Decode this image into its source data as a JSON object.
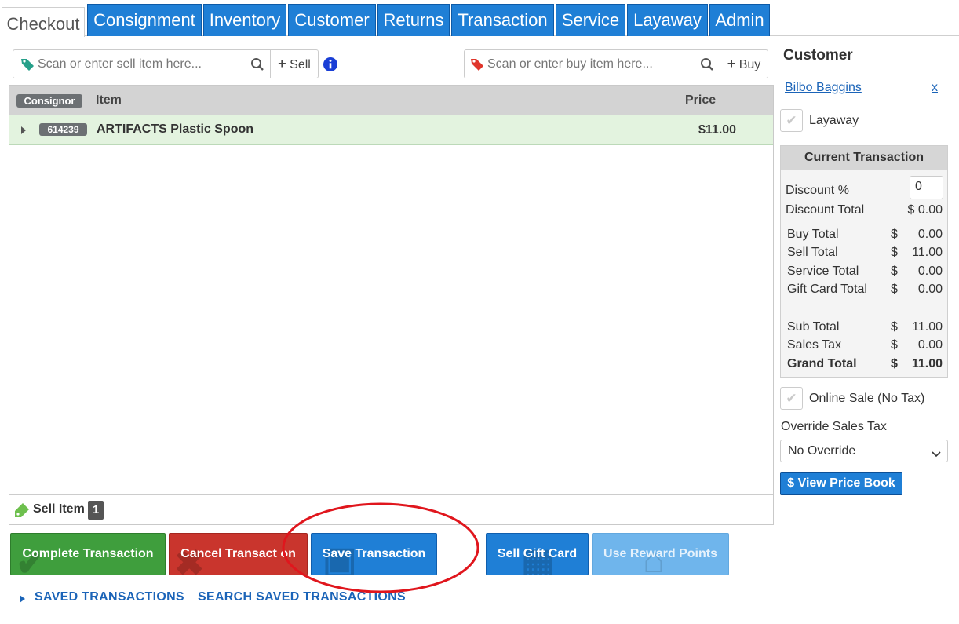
{
  "tabs": [
    {
      "label": "Checkout"
    },
    {
      "label": "Consignment"
    },
    {
      "label": "Inventory"
    },
    {
      "label": "Customer"
    },
    {
      "label": "Returns"
    },
    {
      "label": "Transaction"
    },
    {
      "label": "Service"
    },
    {
      "label": "Layaway"
    },
    {
      "label": "Admin"
    }
  ],
  "sell_search": {
    "placeholder": "Scan or enter sell item here...",
    "add_label": "Sell"
  },
  "buy_search": {
    "placeholder": "Scan or enter buy item here...",
    "add_label": "Buy"
  },
  "items_table": {
    "headers": {
      "consignor": "Consignor",
      "item": "Item",
      "price": "Price"
    },
    "rows": [
      {
        "consignor": "614239",
        "item": "ARTIFACTS Plastic Spoon",
        "price": "$11.00"
      }
    ],
    "footer": {
      "label": "Sell Item",
      "count": "1"
    }
  },
  "actions": {
    "complete": "Complete Transaction",
    "cancel": "Cancel Transact on",
    "save": "Save Transaction",
    "gift_card": "Sell Gift Card",
    "reward": "Use Reward Points"
  },
  "links": {
    "saved": "SAVED TRANSACTIONS",
    "search_saved": "SEARCH SAVED TRANSACTIONS"
  },
  "sidebar": {
    "title": "Customer",
    "customer_name": "Bilbo Baggins",
    "remove": "x",
    "layaway_label": "Layaway",
    "current_transaction": {
      "title": "Current Transaction",
      "discount_label": "Discount %",
      "discount_value": "0",
      "discount_total_label": "Discount Total",
      "discount_total_value": "$ 0.00",
      "currency": "$",
      "lines": [
        {
          "label": "Buy Total",
          "value": "0.00"
        },
        {
          "label": "Sell Total",
          "value": "11.00"
        },
        {
          "label": "Service Total",
          "value": "0.00"
        },
        {
          "label": "Gift Card Total",
          "value": "0.00"
        },
        {
          "label": "Sub Total",
          "value": "11.00"
        },
        {
          "label": "Sales Tax",
          "value": "0.00"
        },
        {
          "label": "Grand Total",
          "value": "11.00"
        }
      ]
    },
    "online_sale_label": "Online Sale (No Tax)",
    "override_label": "Override Sales Tax",
    "override_value": "No Override",
    "price_book": "$ View Price Book"
  },
  "colors": {
    "tab_blue": "#1f7fd6",
    "complete_green": "#3f9e3d",
    "cancel_red": "#c9352d",
    "save_blue": "#1f7fd6",
    "reward_disabled": "#6fb5ec",
    "annotation_red": "#e0161d"
  },
  "icons": {
    "sell_tag": "green-tag-icon",
    "buy_tag": "red-tag-icon",
    "search": "search-icon",
    "info": "info-icon"
  }
}
